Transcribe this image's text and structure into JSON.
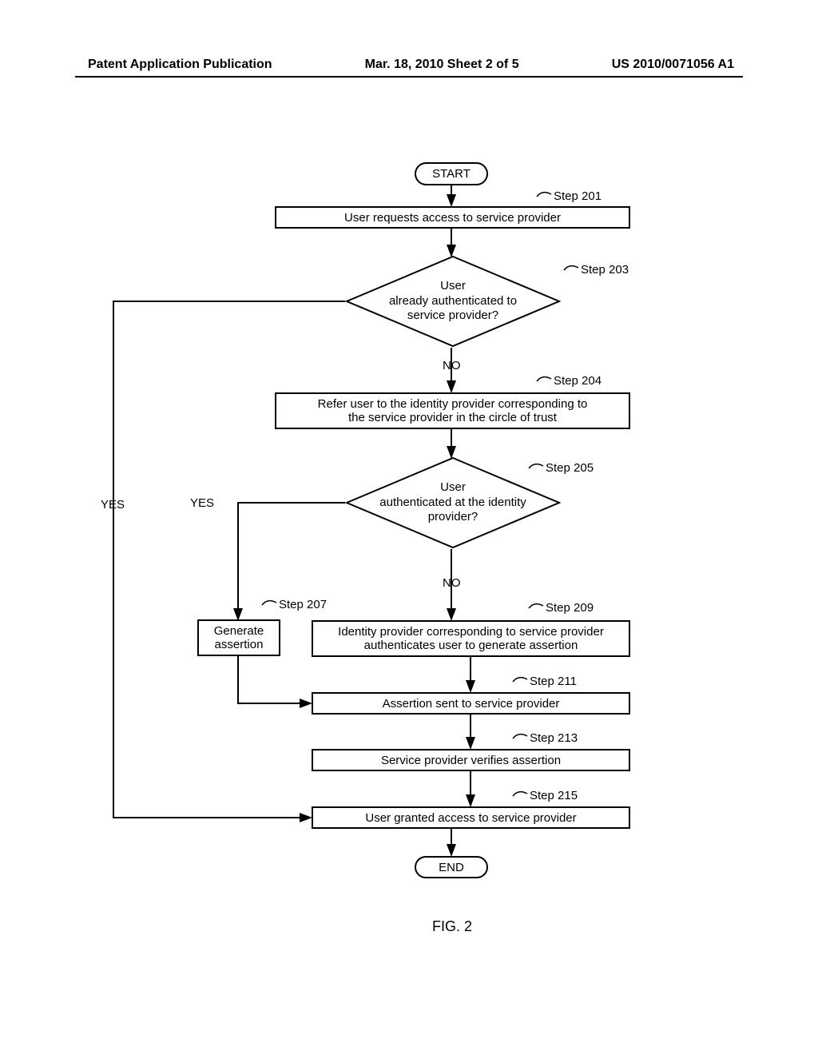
{
  "header": {
    "left": "Patent Application Publication",
    "center": "Mar. 18, 2010  Sheet 2 of 5",
    "right": "US 2010/0071056 A1"
  },
  "diagram": {
    "start": "START",
    "end": "END",
    "step201_label": "Step 201",
    "step201_text": "User requests access to service provider",
    "step203_label": "Step 203",
    "step203_text": "User\nalready authenticated to\nservice provider?",
    "step204_label": "Step 204",
    "step204_text": "Refer user to the identity provider corresponding to\nthe service provider in the circle of trust",
    "step205_label": "Step 205",
    "step205_text": "User\nauthenticated at the identity\nprovider?",
    "step207_label": "Step 207",
    "step207_text": "Generate\nassertion",
    "step209_label": "Step 209",
    "step209_text": "Identity provider corresponding to service provider\nauthenticates user to generate assertion",
    "step211_label": "Step 211",
    "step211_text": "Assertion sent to service provider",
    "step213_label": "Step 213",
    "step213_text": "Service provider verifies assertion",
    "step215_label": "Step 215",
    "step215_text": "User granted access to service provider",
    "yes": "YES",
    "no": "NO",
    "figure": "FIG. 2"
  }
}
